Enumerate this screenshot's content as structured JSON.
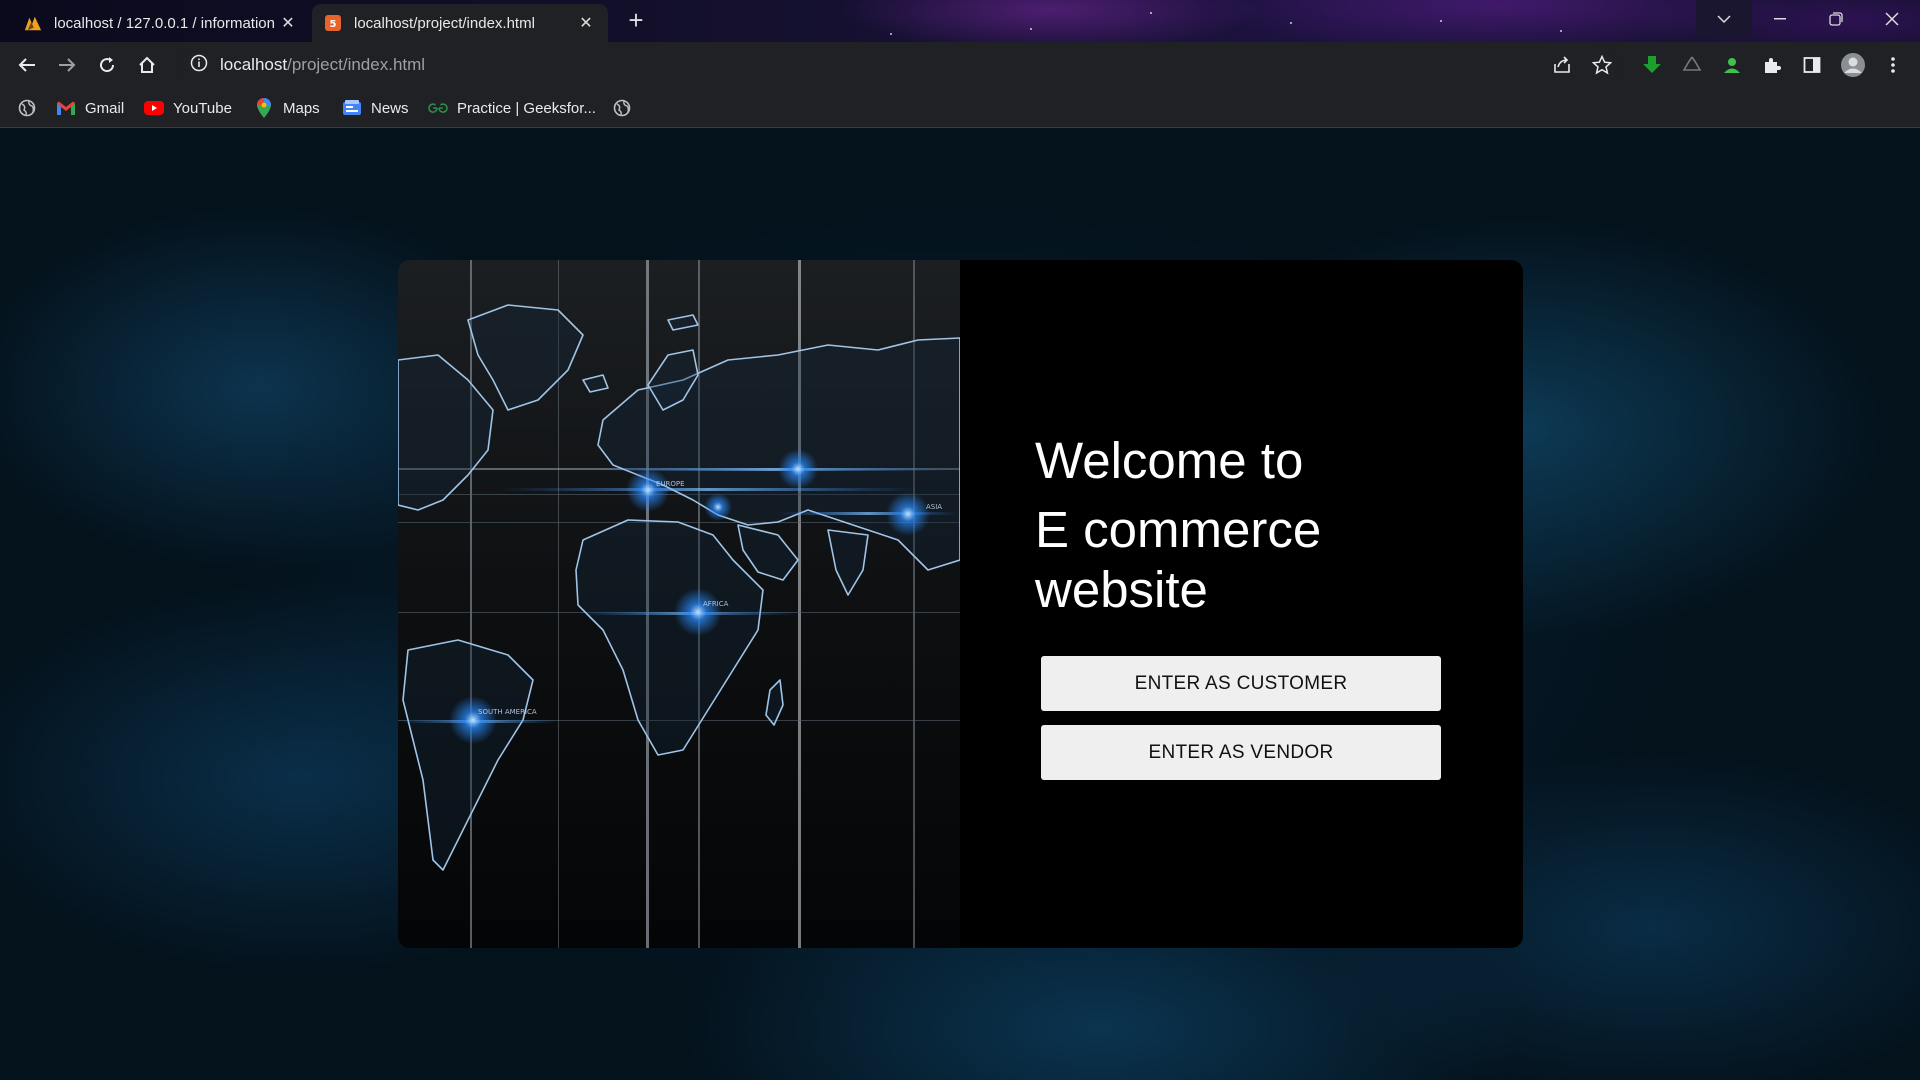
{
  "browser": {
    "tabs": [
      {
        "title": "localhost / 127.0.0.1 / information",
        "favicon": "phpmyadmin-icon",
        "active": false
      },
      {
        "title": "localhost/project/index.html",
        "favicon": "html5-icon",
        "active": true
      }
    ],
    "address": {
      "host": "localhost",
      "path": "/project/index.html"
    },
    "bookmarks": [
      {
        "label": "Gmail",
        "icon": "gmail-icon"
      },
      {
        "label": "YouTube",
        "icon": "youtube-icon"
      },
      {
        "label": "Maps",
        "icon": "maps-icon"
      },
      {
        "label": "News",
        "icon": "news-icon"
      },
      {
        "label": "Practice | Geeksfor...",
        "icon": "geeksforgeeks-icon"
      }
    ]
  },
  "page": {
    "heading": {
      "line1": "Welcome to",
      "line2": "E commerce",
      "line3": "website"
    },
    "buttons": {
      "customer": "ENTER AS CUSTOMER",
      "vendor": "ENTER AS VENDOR"
    },
    "map_labels": {
      "europe": "EUROPE",
      "asia": "ASIA",
      "africa": "AFRICA",
      "south_america": "SOUTH AMERICA"
    }
  },
  "colors": {
    "card_bg": "#000000",
    "button_bg": "#efefef",
    "map_glow": "#2a8cff"
  }
}
